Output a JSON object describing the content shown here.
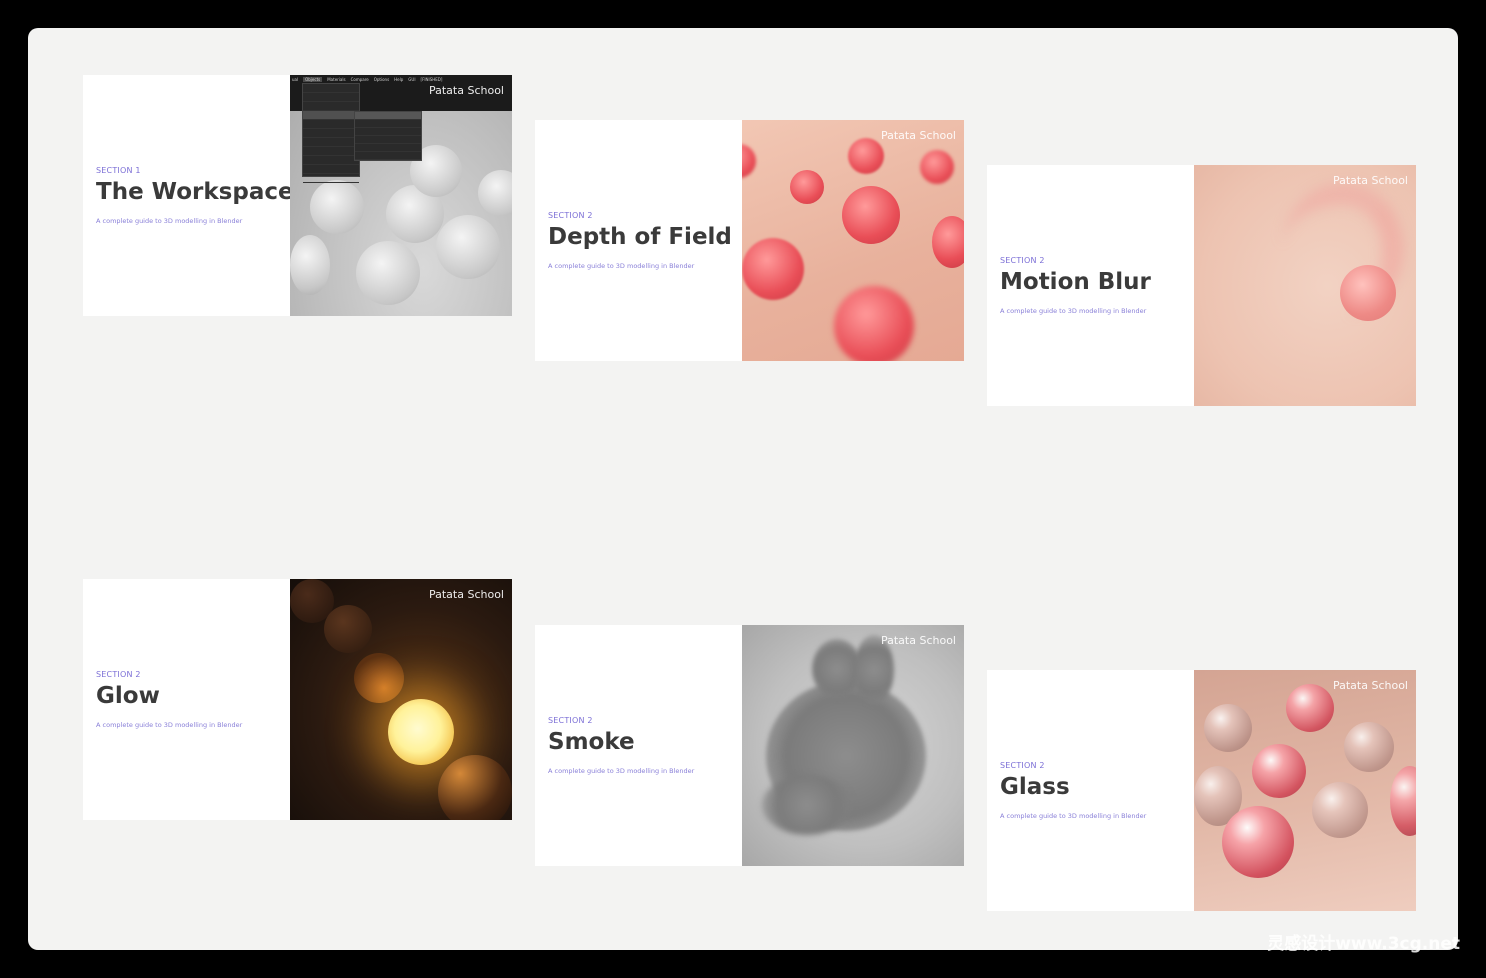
{
  "brand": "Patata School",
  "subtitle": "A complete guide to 3D modelling in Blender",
  "cards": [
    {
      "section": "SECTION 1",
      "title": "The Workspace"
    },
    {
      "section": "SECTION 2",
      "title": "Depth of Field"
    },
    {
      "section": "SECTION 2",
      "title": "Motion Blur"
    },
    {
      "section": "SECTION 2",
      "title": "Glow"
    },
    {
      "section": "SECTION 2",
      "title": "Smoke"
    },
    {
      "section": "SECTION 2",
      "title": "Glass"
    }
  ],
  "workspace_menu": [
    "ual",
    "Objects",
    "Materials",
    "Compare",
    "Options",
    "Help",
    "GUI",
    "[FINISHED]"
  ],
  "watermark": "灵感设计www.3cg.net"
}
